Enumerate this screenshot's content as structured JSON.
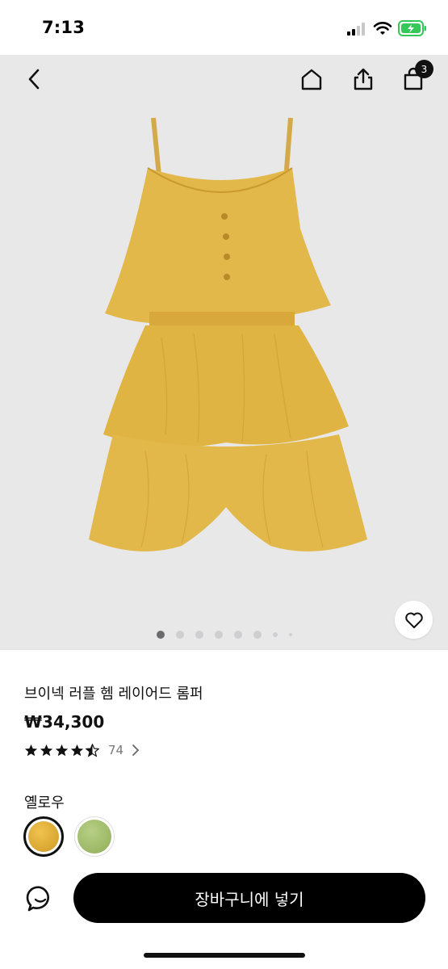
{
  "status_bar": {
    "time": "7:13"
  },
  "header": {
    "back_icon": "chevron-left-icon",
    "home_icon": "home-icon",
    "share_icon": "share-icon",
    "bag_icon": "shopping-bag-icon",
    "bag_count": "3"
  },
  "gallery": {
    "image_count": 8,
    "active_index": 0
  },
  "product": {
    "title": "브이넥 러플 헴 레이어드 롬퍼",
    "price": "₩34,300",
    "rating": 4.5,
    "review_count": "74",
    "color_label": "옐로우",
    "colors": [
      {
        "name": "yellow",
        "hex": "#e0b13c",
        "selected": true
      },
      {
        "name": "green",
        "hex": "#a7c274",
        "selected": false
      }
    ]
  },
  "actions": {
    "chat_icon": "chat-icon",
    "add_to_cart_label": "장바구니에 넣기"
  },
  "colors": {
    "product_yellow": "#e3b84a",
    "background": "#e8e8e9",
    "button": "#000000"
  }
}
